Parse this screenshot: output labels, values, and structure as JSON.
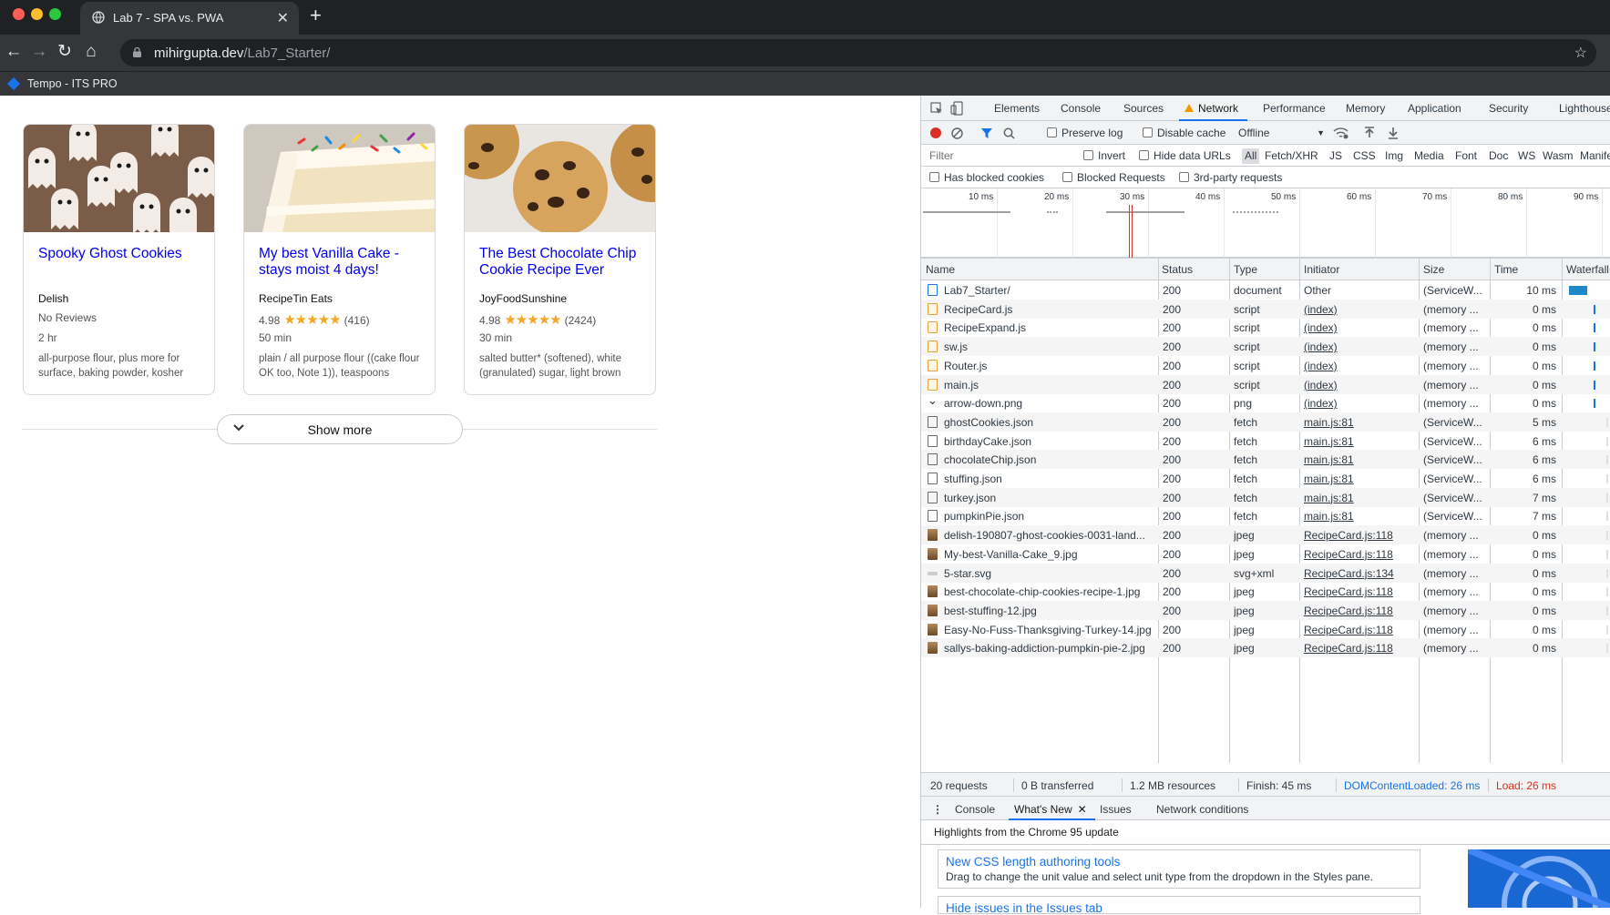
{
  "browser": {
    "tab_title": "Lab 7 - SPA vs. PWA",
    "url_host": "mihirgupta.dev",
    "url_path": "/Lab7_Starter/",
    "bookmark": "Tempo - ITS PRO",
    "icons": {
      "back": "back-arrow-icon",
      "forward": "forward-arrow-icon",
      "reload": "reload-icon",
      "home": "home-icon",
      "lock": "lock-icon",
      "star": "star-icon"
    }
  },
  "page": {
    "cards": [
      {
        "title": "Spooky Ghost Cookies",
        "org": "Delish",
        "rating": "",
        "stars": "",
        "reviews": "No Reviews",
        "time": "2 hr",
        "ingredients": "all-purpose flour, plus more for surface, baking powder, kosher"
      },
      {
        "title": "My best Vanilla Cake - stays moist 4 days!",
        "org": "RecipeTin Eats",
        "rating": "4.98",
        "stars": "★★★★★",
        "reviews": "(416)",
        "time": "50 min",
        "ingredients": "plain / all purpose flour ((cake flour OK too, Note 1)), teaspoons"
      },
      {
        "title": "The Best Chocolate Chip Cookie Recipe Ever",
        "org": "JoyFoodSunshine",
        "rating": "4.98",
        "stars": "★★★★★",
        "reviews": "(2424)",
        "time": "30 min",
        "ingredients": "salted butter* (softened), white (granulated) sugar, light brown"
      }
    ],
    "show_more": "Show more"
  },
  "devtools": {
    "tabs": [
      "Elements",
      "Console",
      "Sources",
      "Network",
      "Performance",
      "Memory",
      "Application",
      "Security",
      "Lighthouse"
    ],
    "active_tab": "Network",
    "toolbar": {
      "preserve_log": "Preserve log",
      "disable_cache": "Disable cache",
      "throttle": "Offline"
    },
    "filter": {
      "placeholder": "Filter",
      "invert": "Invert",
      "hide_data_urls": "Hide data URLs",
      "types": [
        "All",
        "Fetch/XHR",
        "JS",
        "CSS",
        "Img",
        "Media",
        "Font",
        "Doc",
        "WS",
        "Wasm",
        "Manifest"
      ]
    },
    "filter2": {
      "blocked_cookies": "Has blocked cookies",
      "blocked_requests": "Blocked Requests",
      "third_party": "3rd-party requests"
    },
    "timeline_ticks": [
      "10 ms",
      "20 ms",
      "30 ms",
      "40 ms",
      "50 ms",
      "60 ms",
      "70 ms",
      "80 ms",
      "90 ms"
    ],
    "columns": [
      "Name",
      "Status",
      "Type",
      "Initiator",
      "Size",
      "Time",
      "Waterfall"
    ],
    "rows": [
      {
        "name": "Lab7_Starter/",
        "status": "200",
        "type": "document",
        "initiator": "Other",
        "size": "(ServiceW...",
        "time": "10 ms",
        "icon": "doc"
      },
      {
        "name": "RecipeCard.js",
        "status": "200",
        "type": "script",
        "initiator": "(index)",
        "size": "(memory ...",
        "time": "0 ms",
        "icon": "js"
      },
      {
        "name": "RecipeExpand.js",
        "status": "200",
        "type": "script",
        "initiator": "(index)",
        "size": "(memory ...",
        "time": "0 ms",
        "icon": "js"
      },
      {
        "name": "sw.js",
        "status": "200",
        "type": "script",
        "initiator": "(index)",
        "size": "(memory ...",
        "time": "0 ms",
        "icon": "js"
      },
      {
        "name": "Router.js",
        "status": "200",
        "type": "script",
        "initiator": "(index)",
        "size": "(memory ...",
        "time": "0 ms",
        "icon": "js"
      },
      {
        "name": "main.js",
        "status": "200",
        "type": "script",
        "initiator": "(index)",
        "size": "(memory ...",
        "time": "0 ms",
        "icon": "js"
      },
      {
        "name": "arrow-down.png",
        "status": "200",
        "type": "png",
        "initiator": "(index)",
        "size": "(memory ...",
        "time": "0 ms",
        "icon": "png"
      },
      {
        "name": "ghostCookies.json",
        "status": "200",
        "type": "fetch",
        "initiator": "main.js:81",
        "size": "(ServiceW...",
        "time": "5 ms",
        "icon": "fetch"
      },
      {
        "name": "birthdayCake.json",
        "status": "200",
        "type": "fetch",
        "initiator": "main.js:81",
        "size": "(ServiceW...",
        "time": "6 ms",
        "icon": "fetch"
      },
      {
        "name": "chocolateChip.json",
        "status": "200",
        "type": "fetch",
        "initiator": "main.js:81",
        "size": "(ServiceW...",
        "time": "6 ms",
        "icon": "fetch"
      },
      {
        "name": "stuffing.json",
        "status": "200",
        "type": "fetch",
        "initiator": "main.js:81",
        "size": "(ServiceW...",
        "time": "6 ms",
        "icon": "fetch"
      },
      {
        "name": "turkey.json",
        "status": "200",
        "type": "fetch",
        "initiator": "main.js:81",
        "size": "(ServiceW...",
        "time": "7 ms",
        "icon": "fetch"
      },
      {
        "name": "pumpkinPie.json",
        "status": "200",
        "type": "fetch",
        "initiator": "main.js:81",
        "size": "(ServiceW...",
        "time": "7 ms",
        "icon": "fetch"
      },
      {
        "name": "delish-190807-ghost-cookies-0031-land...",
        "status": "200",
        "type": "jpeg",
        "initiator": "RecipeCard.js:118",
        "size": "(memory ...",
        "time": "0 ms",
        "icon": "img"
      },
      {
        "name": "My-best-Vanilla-Cake_9.jpg",
        "status": "200",
        "type": "jpeg",
        "initiator": "RecipeCard.js:118",
        "size": "(memory ...",
        "time": "0 ms",
        "icon": "img"
      },
      {
        "name": "5-star.svg",
        "status": "200",
        "type": "svg+xml",
        "initiator": "RecipeCard.js:134",
        "size": "(memory ...",
        "time": "0 ms",
        "icon": "svg"
      },
      {
        "name": "best-chocolate-chip-cookies-recipe-1.jpg",
        "status": "200",
        "type": "jpeg",
        "initiator": "RecipeCard.js:118",
        "size": "(memory ...",
        "time": "0 ms",
        "icon": "img"
      },
      {
        "name": "best-stuffing-12.jpg",
        "status": "200",
        "type": "jpeg",
        "initiator": "RecipeCard.js:118",
        "size": "(memory ...",
        "time": "0 ms",
        "icon": "img"
      },
      {
        "name": "Easy-No-Fuss-Thanksgiving-Turkey-14.jpg",
        "status": "200",
        "type": "jpeg",
        "initiator": "RecipeCard.js:118",
        "size": "(memory ...",
        "time": "0 ms",
        "icon": "img"
      },
      {
        "name": "sallys-baking-addiction-pumpkin-pie-2.jpg",
        "status": "200",
        "type": "jpeg",
        "initiator": "RecipeCard.js:118",
        "size": "(memory ...",
        "time": "0 ms",
        "icon": "img"
      }
    ],
    "summary": {
      "requests": "20 requests",
      "transferred": "0 B transferred",
      "resources": "1.2 MB resources",
      "finish": "Finish: 45 ms",
      "dcl": "DOMContentLoaded: 26 ms",
      "load": "Load: 26 ms"
    },
    "drawer_tabs": [
      "Console",
      "What's New",
      "Issues",
      "Network conditions"
    ],
    "whats_new": {
      "heading": "Highlights from the Chrome 95 update",
      "items": [
        {
          "title": "New CSS length authoring tools",
          "desc": "Drag to change the unit value and select unit type from the dropdown in the Styles pane."
        },
        {
          "title": "Hide issues in the Issues tab",
          "desc": ""
        }
      ]
    },
    "colors": {
      "accent": "#1a73e8",
      "record": "#d93025",
      "load": "#d93025",
      "dcl": "#1a73e8"
    }
  }
}
